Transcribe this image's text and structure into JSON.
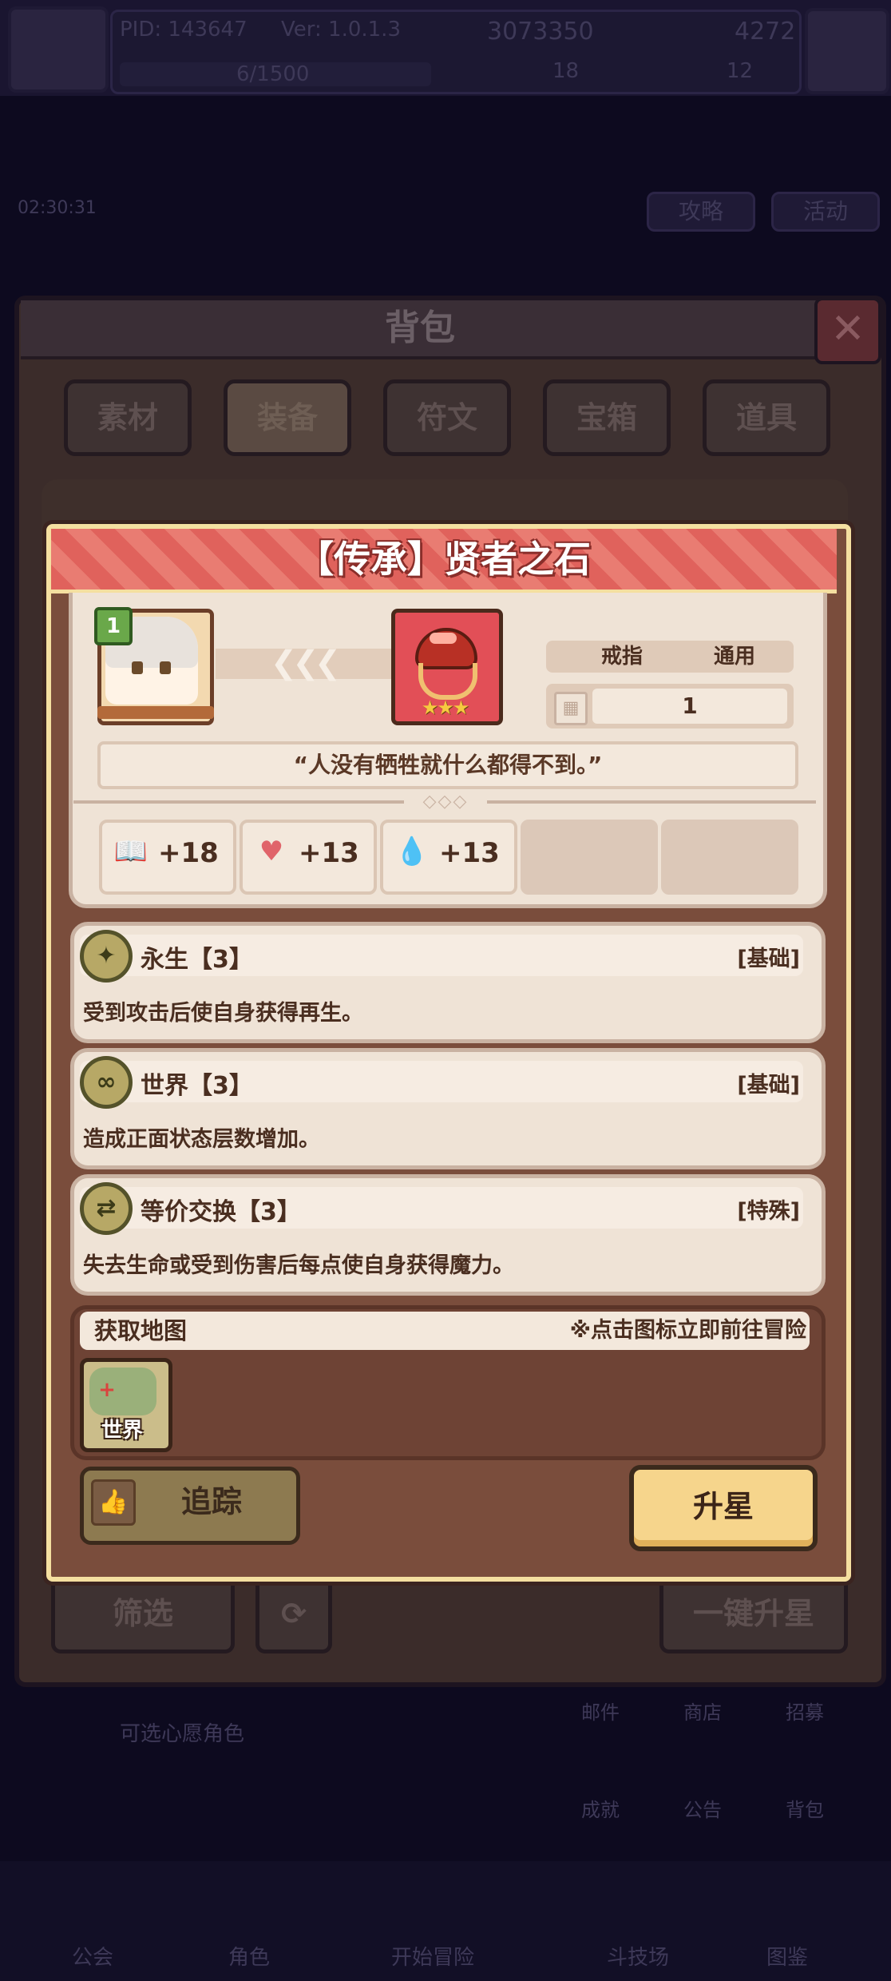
{
  "hud": {
    "pid": "PID: 143647",
    "version": "Ver: 1.0.1.3",
    "gold": "3073350",
    "gems": "4272",
    "exp": "6/1500",
    "clover": "18",
    "keys": "12"
  },
  "background": {
    "timer": "02:30:31",
    "btn_guide": "攻略",
    "btn_event": "活动",
    "wish_text": "可选心愿角色",
    "side_mail": "邮件",
    "side_shop": "商店",
    "side_recruit": "招募",
    "side_achievement": "成就",
    "side_notice": "公告",
    "side_bag": "背包",
    "nav": [
      "公会",
      "角色",
      "开始冒险",
      "斗技场",
      "图鉴"
    ]
  },
  "backpack": {
    "title": "背包",
    "close_glyph": "✕",
    "tabs": [
      "素材",
      "装备",
      "符文",
      "宝箱",
      "道具"
    ],
    "active_tab": "装备",
    "filter_label": "筛选",
    "one_click_star_label": "一键升星"
  },
  "item": {
    "title": "【传承】贤者之石",
    "hero_level": "1",
    "arrows": "❮❮❮",
    "stars": "★★★",
    "tag_slot": "戒指",
    "tag_scope": "通用",
    "quantity": "1",
    "quote": "“人没有牺牲就什么都得不到。”",
    "divider_ornament": "◇◇◇",
    "stats": [
      {
        "icon": "book-icon",
        "glyph": "📖",
        "value": "+18"
      },
      {
        "icon": "heart-icon",
        "glyph": "♥",
        "value": "+13"
      },
      {
        "icon": "water-drop-icon",
        "glyph": "💧",
        "value": "+13"
      }
    ],
    "skills": [
      {
        "badge": "✦",
        "name": "永生【3】",
        "type": "[基础]",
        "desc": "受到攻击后使自身获得再生。"
      },
      {
        "badge": "∞",
        "name": "世界【3】",
        "type": "[基础]",
        "desc": "造成正面状态层数增加。"
      },
      {
        "badge": "⇄",
        "name": "等价交换【3】",
        "type": "[特殊]",
        "desc": "失去生命或受到伤害后每点使自身获得魔力。"
      }
    ],
    "map_title": "获取地图",
    "map_hint": "※点击图标立即前往冒险",
    "map_tile_label": "世界",
    "map_tile_glyph": "+",
    "track_label": "追踪",
    "track_glyph": "👍",
    "star_up_label": "升星"
  },
  "colors": {
    "header_red": "#e0625c",
    "dialog_border": "#f5dfa0",
    "card_bg": "#efe3d6",
    "star_button": "#f6d58c",
    "track_button": "#8d7a50"
  }
}
